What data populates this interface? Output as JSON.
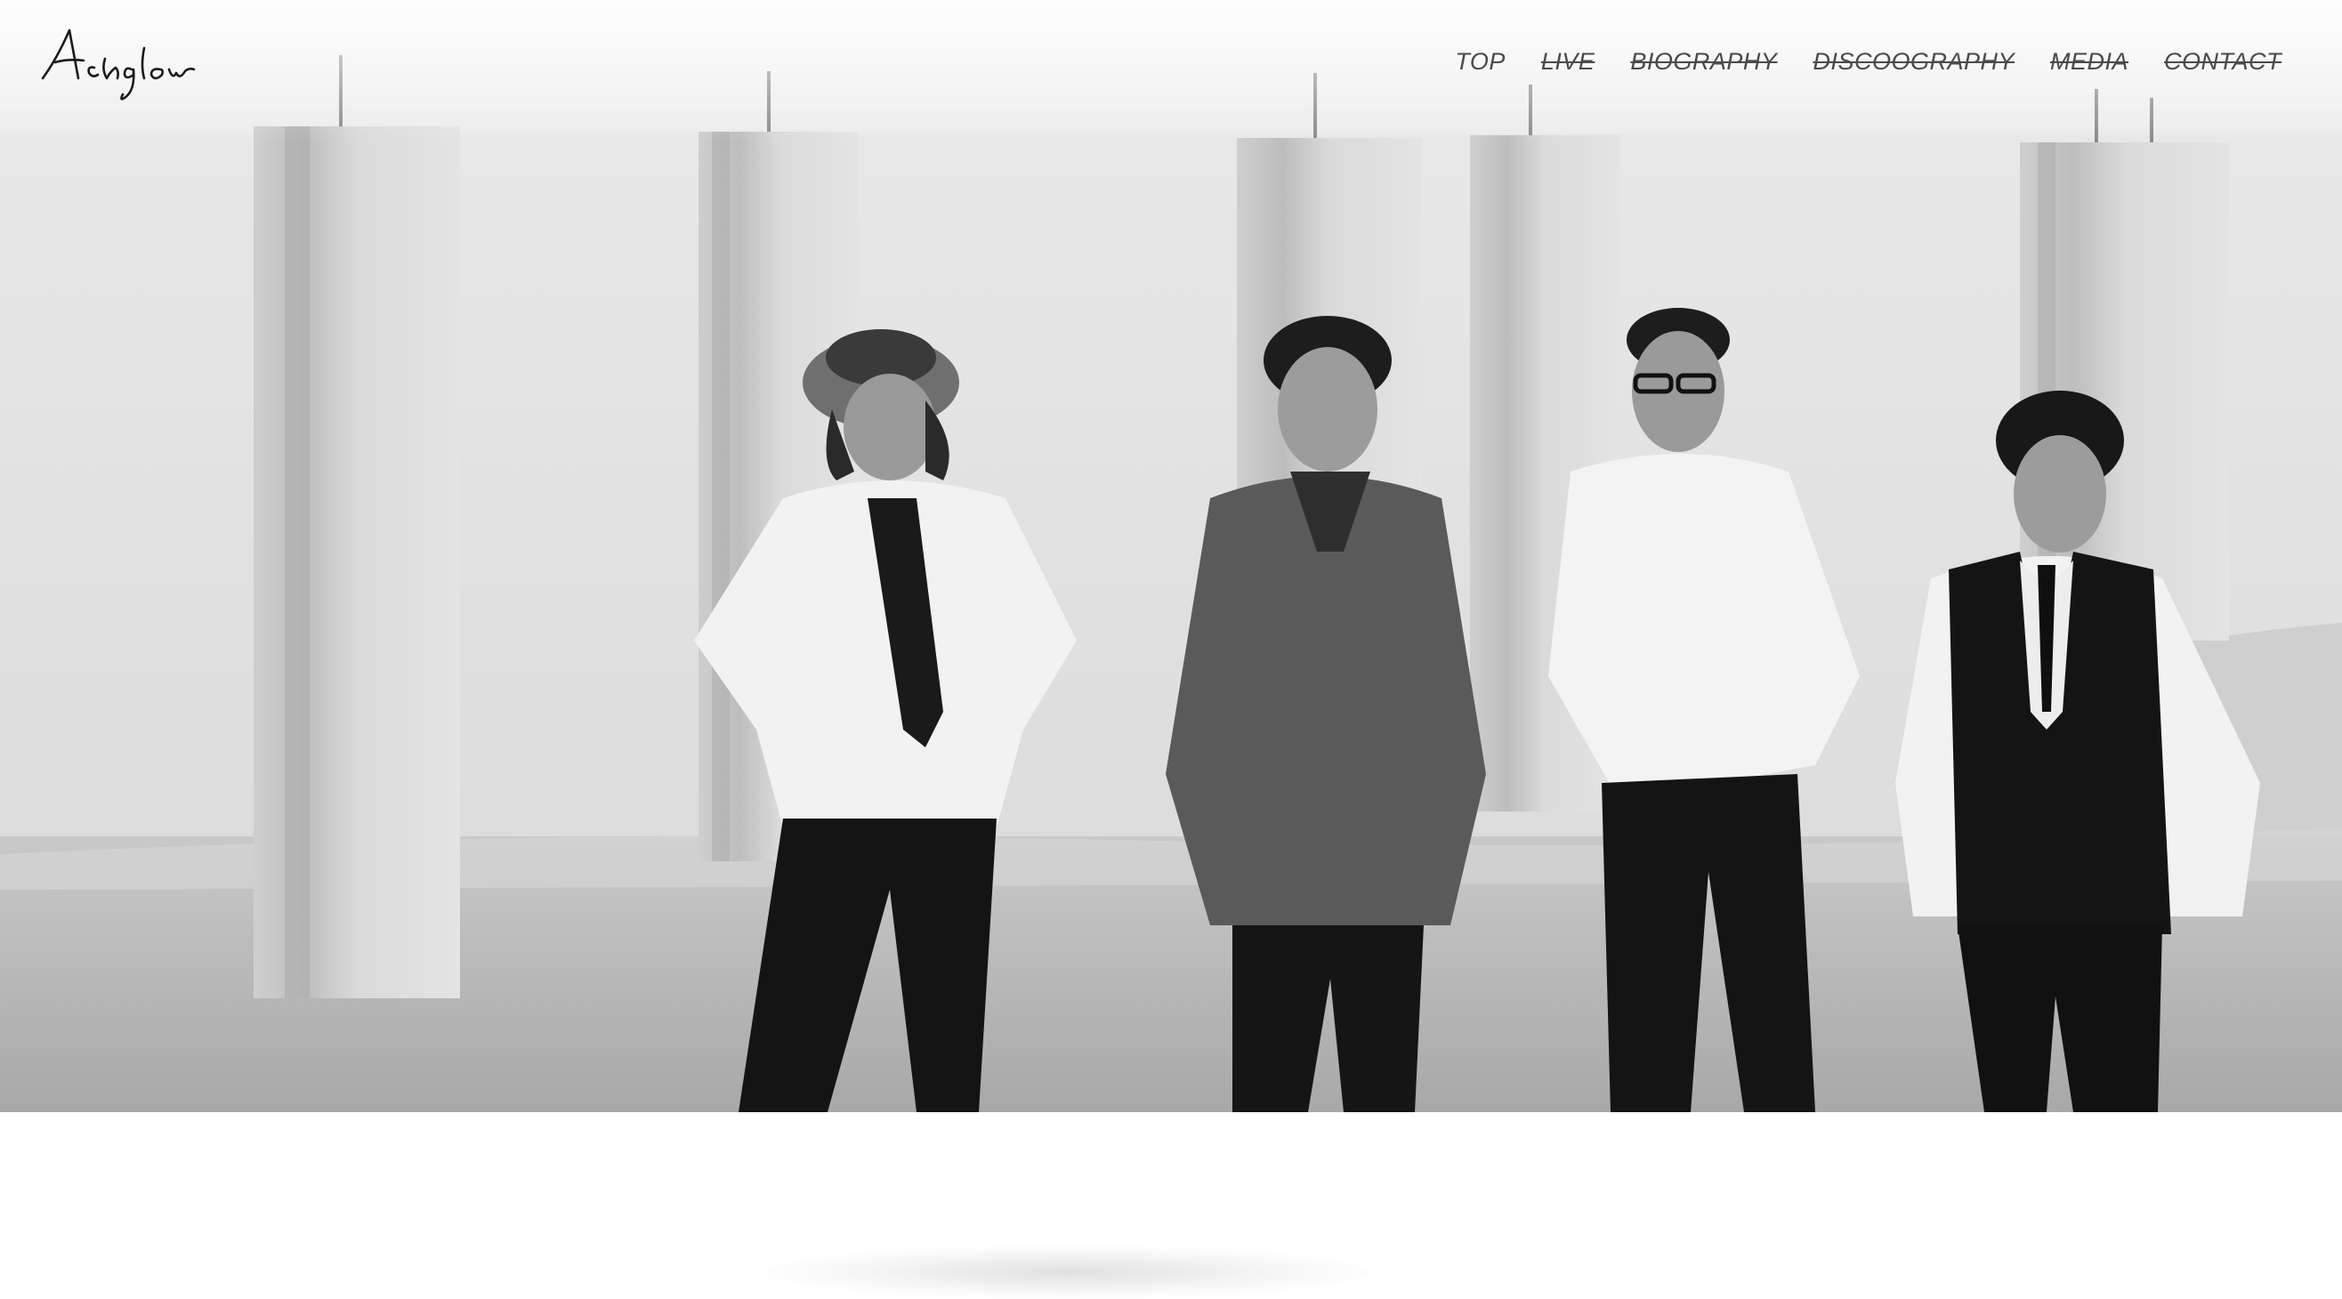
{
  "site": {
    "logo_text": "Ashglow"
  },
  "nav": {
    "items": [
      {
        "label": "TOP",
        "struck": false
      },
      {
        "label": "LIVE",
        "struck": true
      },
      {
        "label": "BIOGRAPHY",
        "struck": true
      },
      {
        "label": "DISCOOGRAPHY",
        "struck": true
      },
      {
        "label": "MEDIA",
        "struck": true
      },
      {
        "label": "CONTACT",
        "struck": true
      }
    ]
  },
  "colors": {
    "nav_text": "#4a4a4a",
    "background": "#ffffff"
  }
}
